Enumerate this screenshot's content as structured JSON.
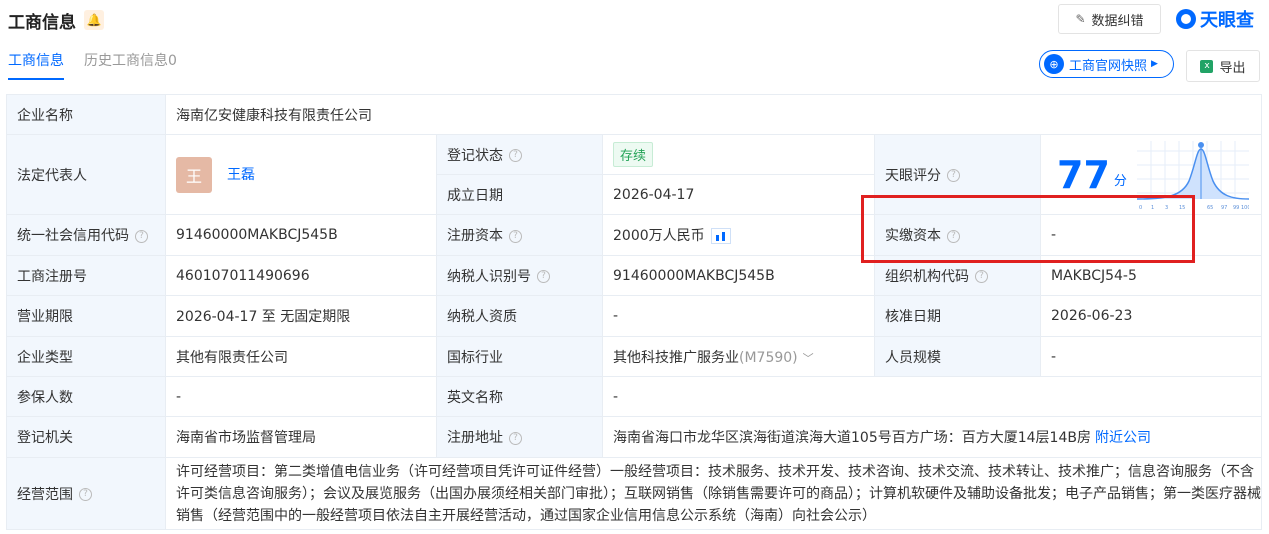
{
  "header": {
    "title": "工商信息",
    "correction_label": "数据纠错",
    "logo_text": "天眼查"
  },
  "tabs": [
    {
      "label": "工商信息"
    },
    {
      "label": "历史工商信息0"
    }
  ],
  "toolbar": {
    "snapshot_label": "工商官网快照",
    "export_label": "导出"
  },
  "company": {
    "name_label": "企业名称",
    "name_value": "海南亿安健康科技有限责任公司",
    "legal_rep_label": "法定代表人",
    "legal_rep_avatar": "王",
    "legal_rep_name": "王磊",
    "reg_status_label": "登记状态",
    "reg_status_value": "存续",
    "established_label": "成立日期",
    "established_value": "2026-04-17",
    "score_label": "天眼评分",
    "score_value": "77",
    "score_unit": "分",
    "credit_code_label": "统一社会信用代码",
    "credit_code_value": "91460000MAKBCJ545B",
    "reg_capital_label": "注册资本",
    "reg_capital_value": "2000万人民币",
    "paid_capital_label": "实缴资本",
    "paid_capital_value": "-",
    "reg_no_label": "工商注册号",
    "reg_no_value": "460107011490696",
    "taxpayer_id_label": "纳税人识别号",
    "taxpayer_id_value": "91460000MAKBCJ545B",
    "org_code_label": "组织机构代码",
    "org_code_value": "MAKBCJ54-5",
    "term_label": "营业期限",
    "term_value": "2026-04-17 至 无固定期限",
    "taxpayer_qual_label": "纳税人资质",
    "taxpayer_qual_value": "-",
    "approve_date_label": "核准日期",
    "approve_date_value": "2026-06-23",
    "type_label": "企业类型",
    "type_value": "其他有限责任公司",
    "industry_label": "国标行业",
    "industry_value": "其他科技推广服务业",
    "industry_code": "(M7590)",
    "staff_size_label": "人员规模",
    "staff_size_value": "-",
    "insured_label": "参保人数",
    "insured_value": "-",
    "en_name_label": "英文名称",
    "en_name_value": "-",
    "authority_label": "登记机关",
    "authority_value": "海南省市场监督管理局",
    "address_label": "注册地址",
    "address_value": "海南省海口市龙华区滨海街道滨海大道105号百方广场：百方大厦14层14B房",
    "nearby_label": "附近公司",
    "scope_label": "经营范围",
    "scope_value": "许可经营项目：第二类增值电信业务（许可经营项目凭许可证件经营）一般经营项目：技术服务、技术开发、技术咨询、技术交流、技术转让、技术推广；信息咨询服务（不含许可类信息咨询服务）；会议及展览服务（出国办展须经相关部门审批）；互联网销售（除销售需要许可的商品）；计算机软硬件及辅助设备批发；电子产品销售；第一类医疗器械销售（经营范围中的一般经营项目依法自主开展经营活动，通过国家企业信用信息公示系统（海南）向社会公示）"
  },
  "score_chart": {
    "ticks": [
      "0",
      "1",
      "3",
      "15",
      "65",
      "97",
      "99",
      "100"
    ],
    "marker_value": 77
  },
  "colors": {
    "accent": "#0069ff",
    "label_bg": "#f2f7fd",
    "status_green": "#24a357",
    "highlight_red": "#e02020"
  }
}
